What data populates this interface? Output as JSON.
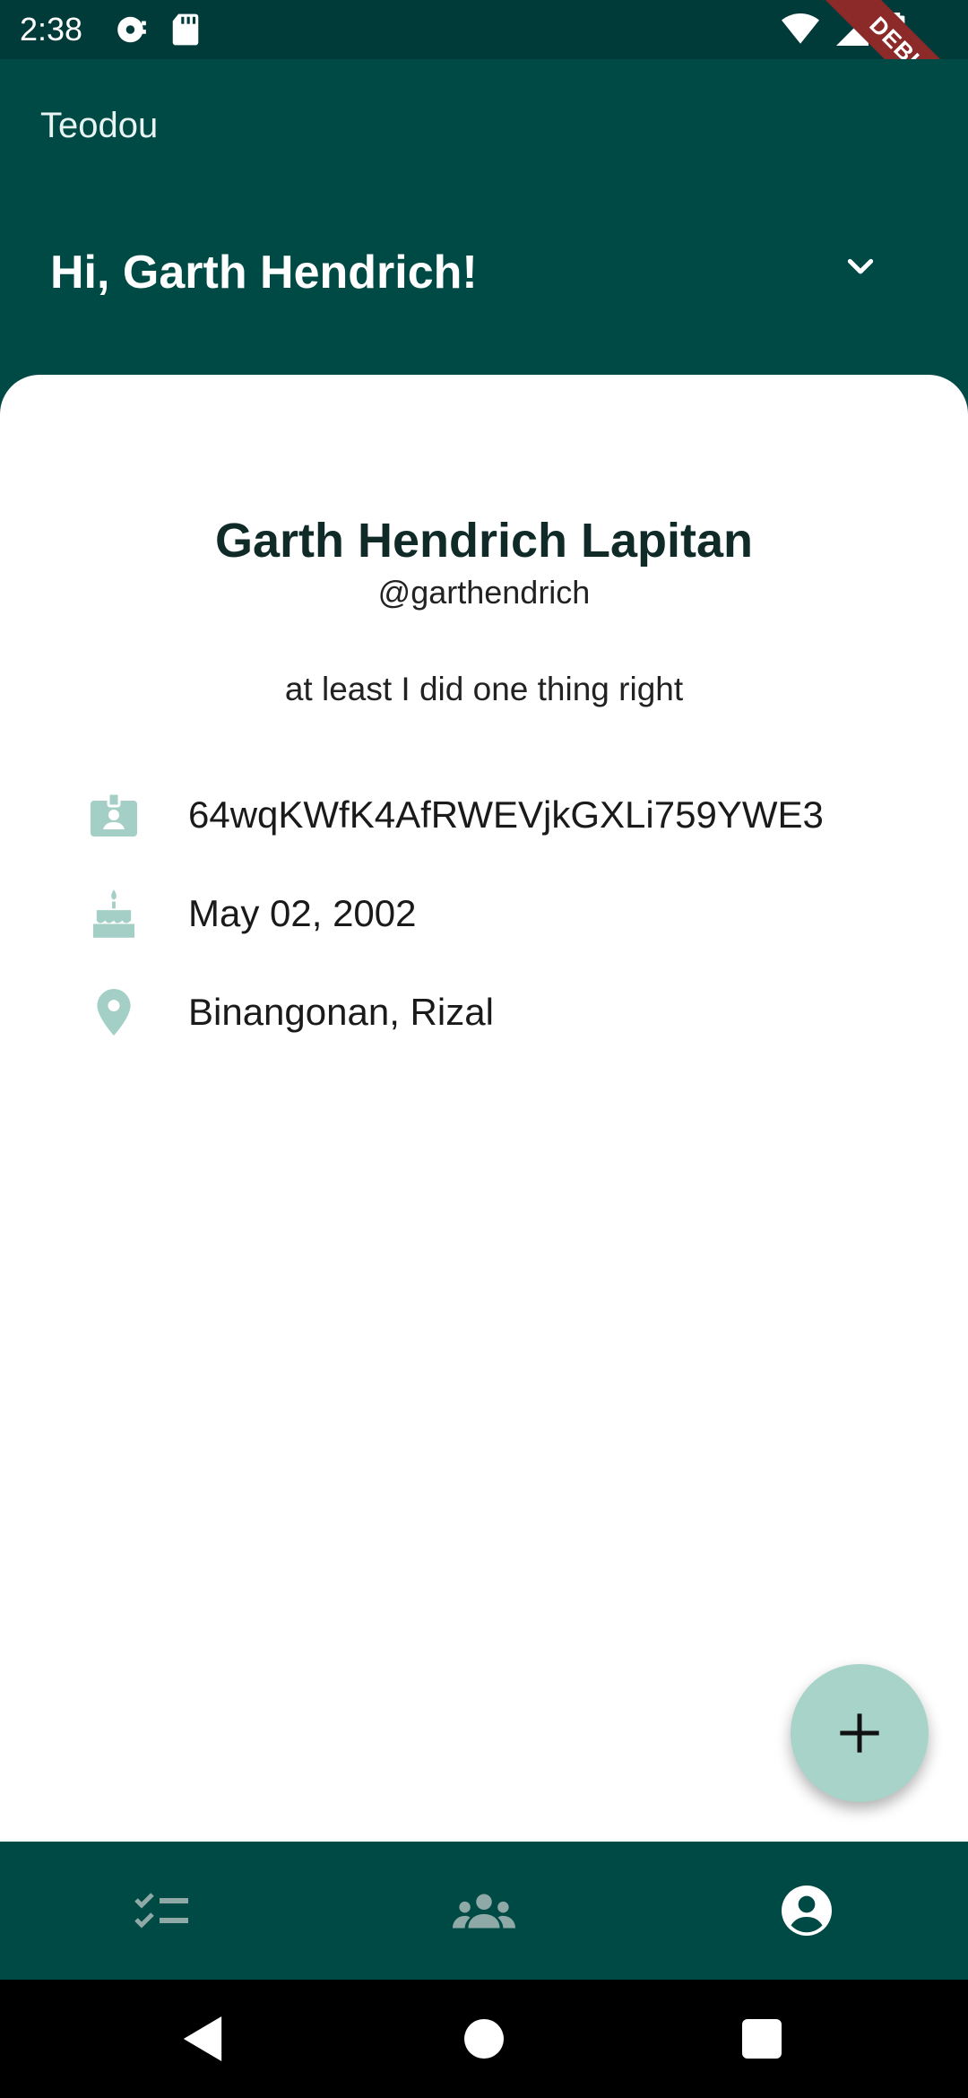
{
  "status_bar": {
    "time": "2:38",
    "debug_label": "DEBUG"
  },
  "header": {
    "app_title": "Teodou",
    "greeting": "Hi, Garth Hendrich!"
  },
  "profile": {
    "full_name": "Garth Hendrich Lapitan",
    "username": "@garthendrich",
    "bio": "at least I did one thing right",
    "details": [
      {
        "icon": "id-badge-icon",
        "text": "64wqKWfK4AfRWEVjkGXLi759YWE3"
      },
      {
        "icon": "cake-icon",
        "text": "May 02, 2002"
      },
      {
        "icon": "location-pin-icon",
        "text": "Binangonan, Rizal"
      }
    ]
  },
  "bottom_nav": {
    "items": [
      {
        "name": "tasks",
        "icon": "checklist-icon",
        "active": false
      },
      {
        "name": "friends",
        "icon": "group-icon",
        "active": false
      },
      {
        "name": "profile",
        "icon": "account-circle-icon",
        "active": true
      }
    ]
  },
  "colors": {
    "primary": "#004a46",
    "accent": "#a8d3c9",
    "icon_muted": "#a4cfc6",
    "nav_inactive": "#8fa9a6"
  }
}
